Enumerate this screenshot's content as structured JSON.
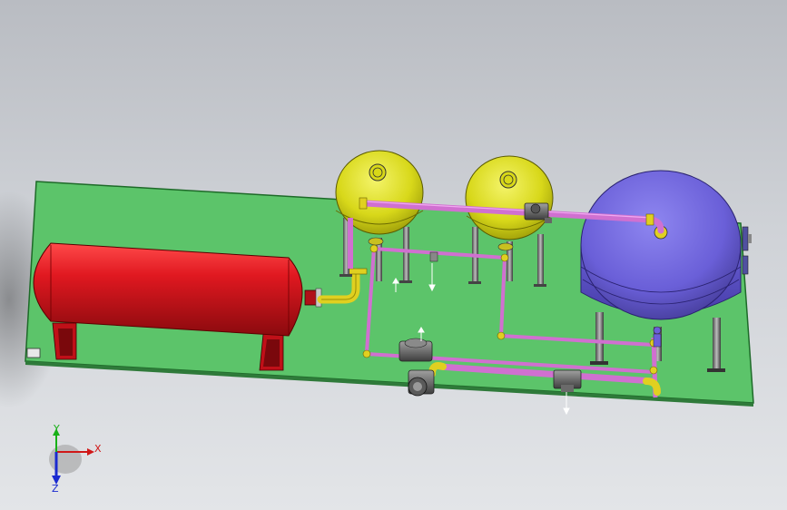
{
  "colors": {
    "base_plate": "#5cc46a",
    "tank_red": "#d8141c",
    "tank_yellow": "#dede1a",
    "tank_blue": "#6a5fd8",
    "pipe_pink": "#d070d0",
    "pipe_yellow": "#e0d020",
    "valve_gray": "#7a7a7a",
    "axis_x": "#d01818",
    "axis_y": "#18b018",
    "axis_z": "#1a2ad0"
  },
  "triad": {
    "x_label": "X",
    "y_label": "Y",
    "z_label": "Z"
  }
}
